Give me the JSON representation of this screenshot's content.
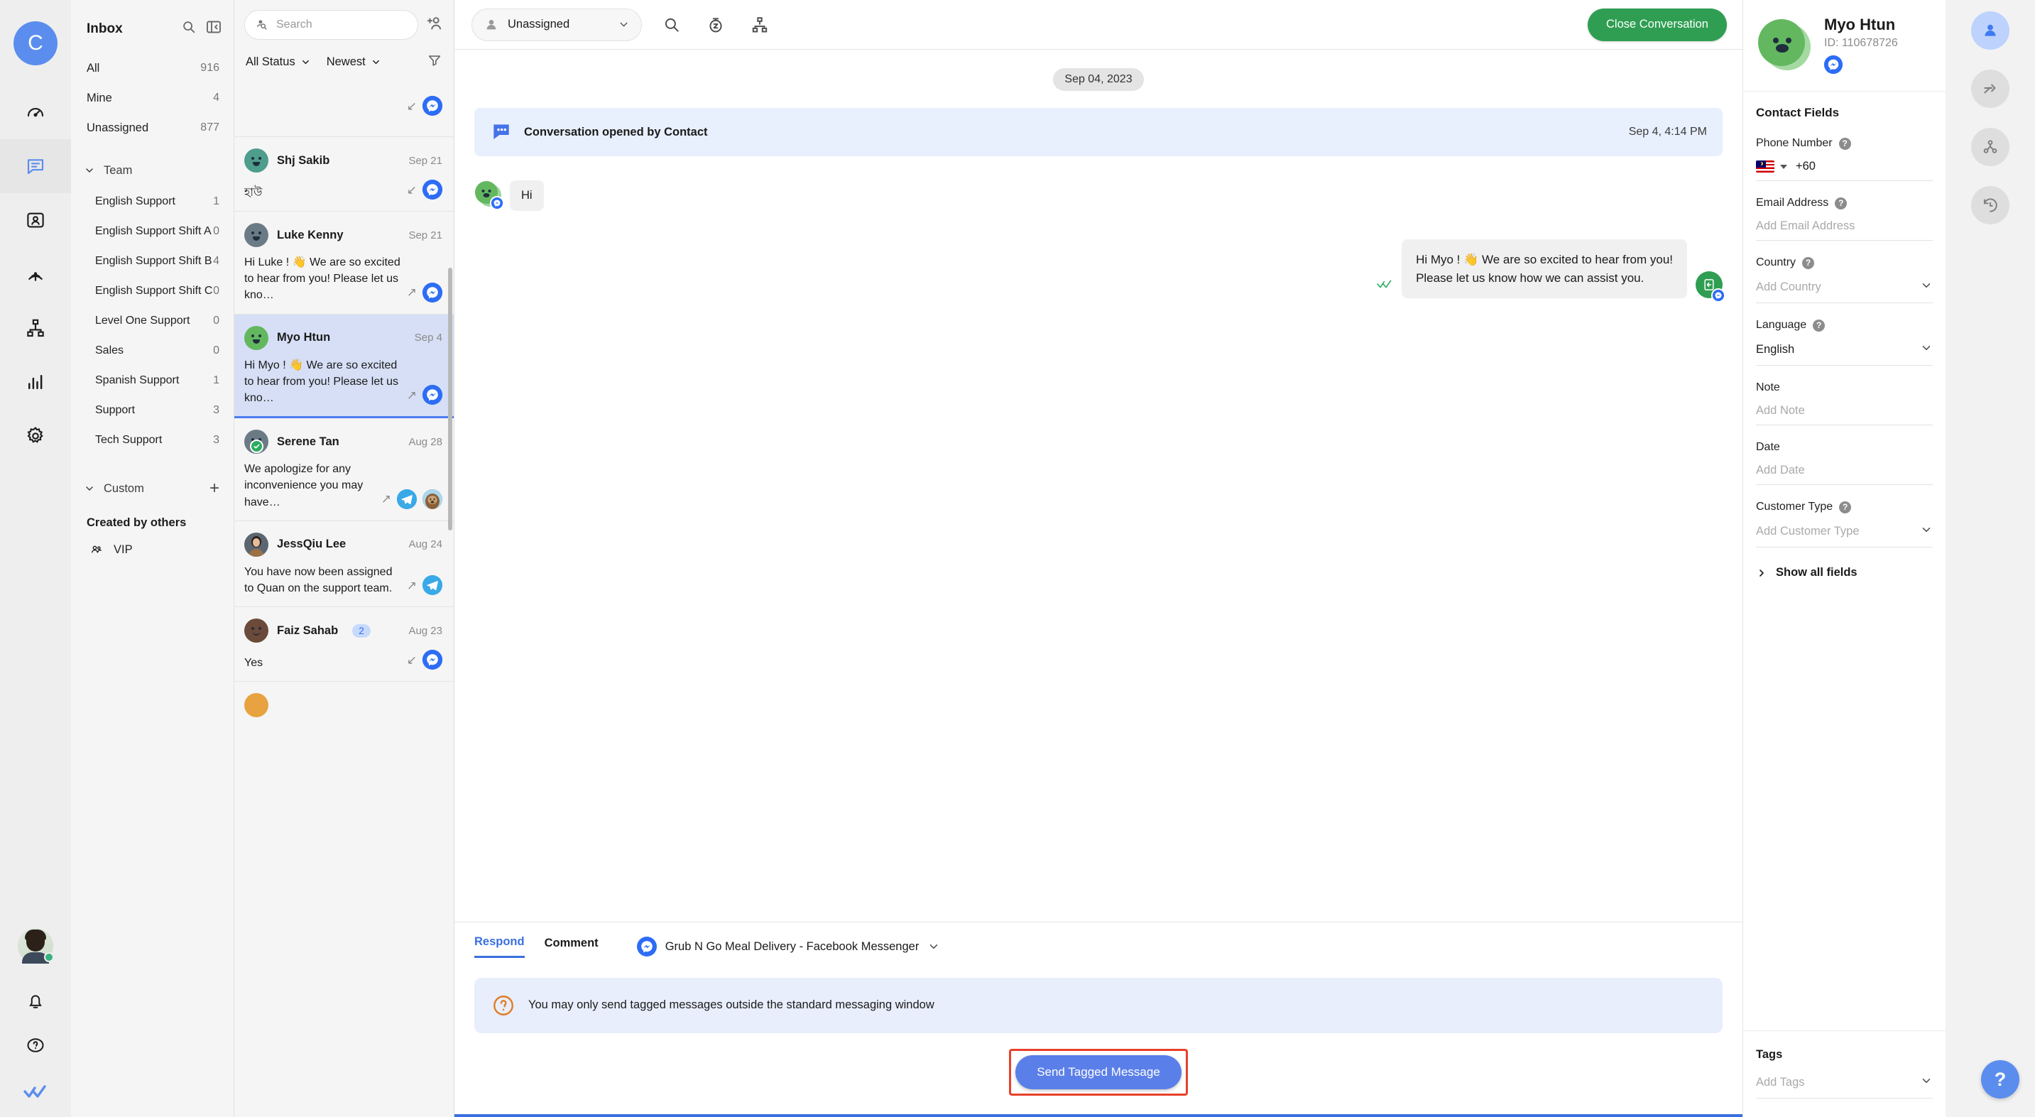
{
  "rail": {
    "workspace_initial": "C",
    "items": [
      {
        "name": "dashboard-icon",
        "label": "Dashboard"
      },
      {
        "name": "inbox-icon",
        "label": "Inbox",
        "active": true
      },
      {
        "name": "contacts-icon",
        "label": "Contacts"
      },
      {
        "name": "broadcast-icon",
        "label": "Broadcasts"
      },
      {
        "name": "workflows-icon",
        "label": "Workflows"
      },
      {
        "name": "reports-icon",
        "label": "Reports"
      },
      {
        "name": "settings-icon",
        "label": "Settings"
      }
    ],
    "bottom": [
      {
        "name": "user-photo",
        "label": "Profile"
      },
      {
        "name": "notifications-icon",
        "label": "Notifications"
      },
      {
        "name": "help-icon",
        "label": "Help"
      },
      {
        "name": "respond-logo-icon",
        "label": "respond.io"
      }
    ]
  },
  "inbox": {
    "title": "Inbox",
    "search_icon": "search-icon",
    "collapse_icon": "collapse-panel-icon",
    "primary": [
      {
        "label": "All",
        "count": "916"
      },
      {
        "label": "Mine",
        "count": "4"
      },
      {
        "label": "Unassigned",
        "count": "877"
      }
    ],
    "team_group_label": "Team",
    "teams": [
      {
        "label": "English Support",
        "count": "1"
      },
      {
        "label": "English Support Shift A",
        "count": "0"
      },
      {
        "label": "English Support Shift B",
        "count": "4"
      },
      {
        "label": "English Support Shift C",
        "count": "0"
      },
      {
        "label": "Level One Support",
        "count": "0"
      },
      {
        "label": "Sales",
        "count": "0"
      },
      {
        "label": "Spanish Support",
        "count": "1"
      },
      {
        "label": "Support",
        "count": "3"
      },
      {
        "label": "Tech Support",
        "count": "3"
      }
    ],
    "custom_group_label": "Custom",
    "add_custom_label": "+",
    "created_by_others_label": "Created by others",
    "custom_items": [
      {
        "label": "VIP",
        "icon": "people-icon"
      }
    ]
  },
  "conversation_list": {
    "search_placeholder": "Search",
    "add_contact_icon": "add-contact-icon",
    "status_filter": "All Status",
    "sort_filter": "Newest",
    "filter_icon": "filter-icon",
    "items": [
      {
        "name": "",
        "date": "",
        "snippet": "",
        "channel": "messenger",
        "direction": "incoming",
        "partial": true,
        "avatar_color": "#8fb9a8",
        "selected": false
      },
      {
        "name": "Shj Sakib",
        "date": "Sep 21",
        "snippet": "হাউ",
        "channel": "messenger",
        "direction": "incoming",
        "avatar_color": "#4f9d8c",
        "selected": false
      },
      {
        "name": "Luke Kenny",
        "date": "Sep 21",
        "snippet": "Hi Luke ! 👋 We are so excited to hear from you! Please let us kno…",
        "channel": "messenger",
        "direction": "outgoing",
        "avatar_color": "#6b7b86",
        "selected": false
      },
      {
        "name": "Myo Htun",
        "date": "Sep 4",
        "snippet": "Hi Myo ! 👋 We are so excited to hear from you! Please let us kno…",
        "channel": "messenger",
        "direction": "outgoing",
        "avatar_color": "#63b85f",
        "selected": true
      },
      {
        "name": "Serene Tan",
        "date": "Aug 28",
        "snippet": "We apologize for any inconvenience you may have…",
        "channel": "telegram",
        "direction": "outgoing",
        "avatar_color": "#6b7b86",
        "resolved": true,
        "has_agent_photo": true,
        "selected": false
      },
      {
        "name": "JessQiu Lee",
        "date": "Aug 24",
        "snippet": "You have now been assigned to Quan on the support team.",
        "channel": "telegram",
        "direction": "outgoing",
        "avatar_color": "#5c6670",
        "is_photo": true,
        "selected": false
      },
      {
        "name": "Faiz Sahab",
        "date": "Aug 23",
        "snippet": "Yes",
        "badge": "2",
        "channel": "messenger",
        "direction": "incoming",
        "avatar_color": "#6b4a3a",
        "selected": false
      }
    ]
  },
  "chat": {
    "assignee": "Unassigned",
    "assignee_icon": "user-icon",
    "header_icons": [
      {
        "name": "search-icon"
      },
      {
        "name": "snooze-icon"
      },
      {
        "name": "workflow-icon"
      }
    ],
    "close_button": "Close Conversation",
    "date_divider": "Sep 04, 2023",
    "system_event": {
      "icon": "conversation-bubble-icon",
      "text": "Conversation opened by Contact",
      "timestamp": "Sep 4, 4:14 PM"
    },
    "messages": [
      {
        "direction": "incoming",
        "text": "Hi",
        "channel": "messenger",
        "avatar_color": "#63b85f"
      },
      {
        "direction": "outgoing",
        "text": "Hi Myo ! 👋 We are so excited to hear from you!\nPlease let us know how we can assist you.",
        "channel": "messenger",
        "status_icon": "double-check-icon"
      }
    ]
  },
  "composer": {
    "tabs": [
      {
        "label": "Respond",
        "active": true
      },
      {
        "label": "Comment",
        "active": false
      }
    ],
    "channel_icon": "messenger-icon",
    "channel_name": "Grub N Go Meal Delivery - Facebook Messenger",
    "notice_icon": "question-mark-icon",
    "notice_text": "You may only send tagged messages outside the standard messaging window",
    "send_button": "Send Tagged Message"
  },
  "contact": {
    "name": "Myo Htun",
    "id": "ID: 110678726",
    "channel_icon": "messenger-icon",
    "fields_title": "Contact Fields",
    "fields": [
      {
        "label": "Phone Number",
        "help": true,
        "type": "phone",
        "country_flag": "malaysia-flag",
        "value": "+60",
        "placeholder": ""
      },
      {
        "label": "Email Address",
        "help": true,
        "type": "text",
        "value": "",
        "placeholder": "Add Email Address"
      },
      {
        "label": "Country",
        "help": true,
        "type": "select",
        "value": "",
        "placeholder": "Add Country"
      },
      {
        "label": "Language",
        "help": true,
        "type": "select",
        "value": "English",
        "placeholder": ""
      },
      {
        "label": "Note",
        "help": false,
        "type": "text",
        "value": "",
        "placeholder": "Add Note"
      },
      {
        "label": "Date",
        "help": false,
        "type": "text",
        "value": "",
        "placeholder": "Add Date"
      },
      {
        "label": "Customer Type",
        "help": true,
        "type": "select",
        "value": "",
        "placeholder": "Add Customer Type"
      }
    ],
    "show_all_fields": "Show all fields",
    "tags_label": "Tags",
    "tags_placeholder": "Add Tags"
  },
  "right_rail": {
    "items": [
      {
        "name": "contact-details-icon",
        "active": true
      },
      {
        "name": "forward-icon",
        "active": false
      },
      {
        "name": "integrations-icon",
        "active": false
      },
      {
        "name": "history-icon",
        "active": false
      }
    ],
    "help_fab": "?"
  },
  "colors": {
    "accent_blue": "#3a6fe0",
    "brand_blue": "#5b8dee",
    "success_green": "#2f9e52",
    "messenger_blue": "#2d6df6",
    "telegram_blue": "#3aa9e8",
    "highlight_red": "#e8402a",
    "selected_row": "#d6dff5"
  }
}
